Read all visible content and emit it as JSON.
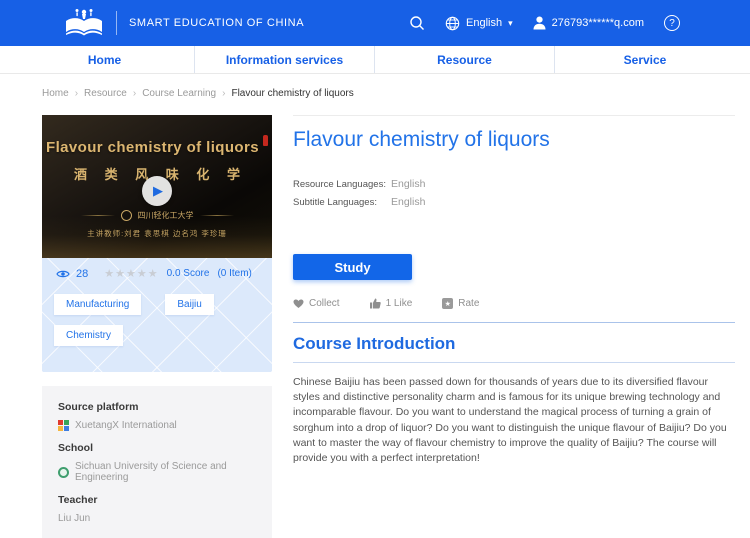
{
  "header": {
    "brand": "SMART EDUCATION OF CHINA",
    "language": "English",
    "user_email": "276793******q.com",
    "help_glyph": "?"
  },
  "nav": {
    "items": [
      "Home",
      "Information services",
      "Resource",
      "Service"
    ]
  },
  "breadcrumb": {
    "separator": "›",
    "items": [
      "Home",
      "Resource",
      "Course Learning"
    ],
    "current": "Flavour chemistry of liquors"
  },
  "course": {
    "title": "Flavour chemistry of liquors",
    "thumbnail": {
      "title": "Flavour chemistry of liquors",
      "title_cn": "酒 类 风 味 化 学",
      "university_cn": "四川轻化工大学",
      "teachers_cn": "主讲教师:刘君 袁思棋 边名鸿 李珍珊"
    },
    "views": "28",
    "score": "0.0 Score",
    "score_items": "(0 Item)",
    "tags": [
      "Manufacturing",
      "Baijiu",
      "Chemistry"
    ],
    "resource_languages_label": "Resource Languages:",
    "resource_languages": "English",
    "subtitle_languages_label": "Subtitle Languages:",
    "subtitle_languages": "English",
    "study_label": "Study",
    "actions": {
      "collect": "Collect",
      "like": "1 Like",
      "rate": "Rate"
    },
    "intro_title": "Course Introduction",
    "intro_text": "Chinese Baijiu has been passed down for thousands of years due to its diversified flavour styles and distinctive personality charm and is famous for its unique brewing technology and incomparable flavour. Do you want to understand the magical process of turning a grain of sorghum into a drop of liquor? Do you want to distinguish the unique flavour of Baijiu? Do you want to master the way of flavour chemistry to improve the quality of Baijiu? The course will provide you with a perfect interpretation!"
  },
  "info_box": {
    "source_platform_label": "Source platform",
    "source_platform": "XuetangX International",
    "school_label": "School",
    "school": "Sichuan University of Science and Engineering",
    "teacher_label": "Teacher",
    "teacher": "Liu Jun"
  },
  "icons": {
    "star": "★",
    "chevron_down": "▾",
    "play": "▶",
    "rate_glyph": "★"
  },
  "colors": {
    "header_blue": "#1760e6",
    "accent_blue": "#2273e8",
    "panel_blue": "#dce9fb",
    "gold": "#d9b46f",
    "button_blue": "#1266e8"
  }
}
